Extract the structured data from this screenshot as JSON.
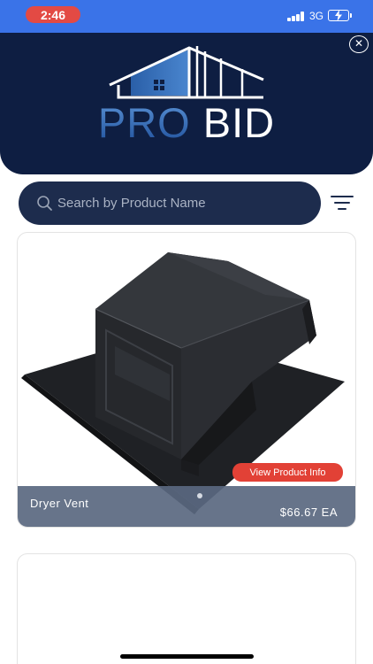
{
  "status_bar": {
    "time": "2:46",
    "network": "3G"
  },
  "header": {
    "logo_word_1": "PRO",
    "logo_word_2": "BID",
    "close_symbol": "✕"
  },
  "search": {
    "placeholder": "Search by Product Name"
  },
  "products": [
    {
      "name": "Dryer Vent",
      "price": "$66.67 EA",
      "info_button_label": "View Product Info"
    }
  ],
  "colors": {
    "status_bar": "#3a73e8",
    "time_pill": "#e34a44",
    "header_bg": "#0e1e42",
    "search_bg": "#1d2c4d",
    "accent_red": "#e24136",
    "logo_blue": "#3d78c4"
  },
  "icons": {
    "close": "close-icon",
    "search": "search-icon",
    "filter": "filter-icon",
    "battery": "battery-charging-icon",
    "signal": "signal-bars-icon"
  }
}
